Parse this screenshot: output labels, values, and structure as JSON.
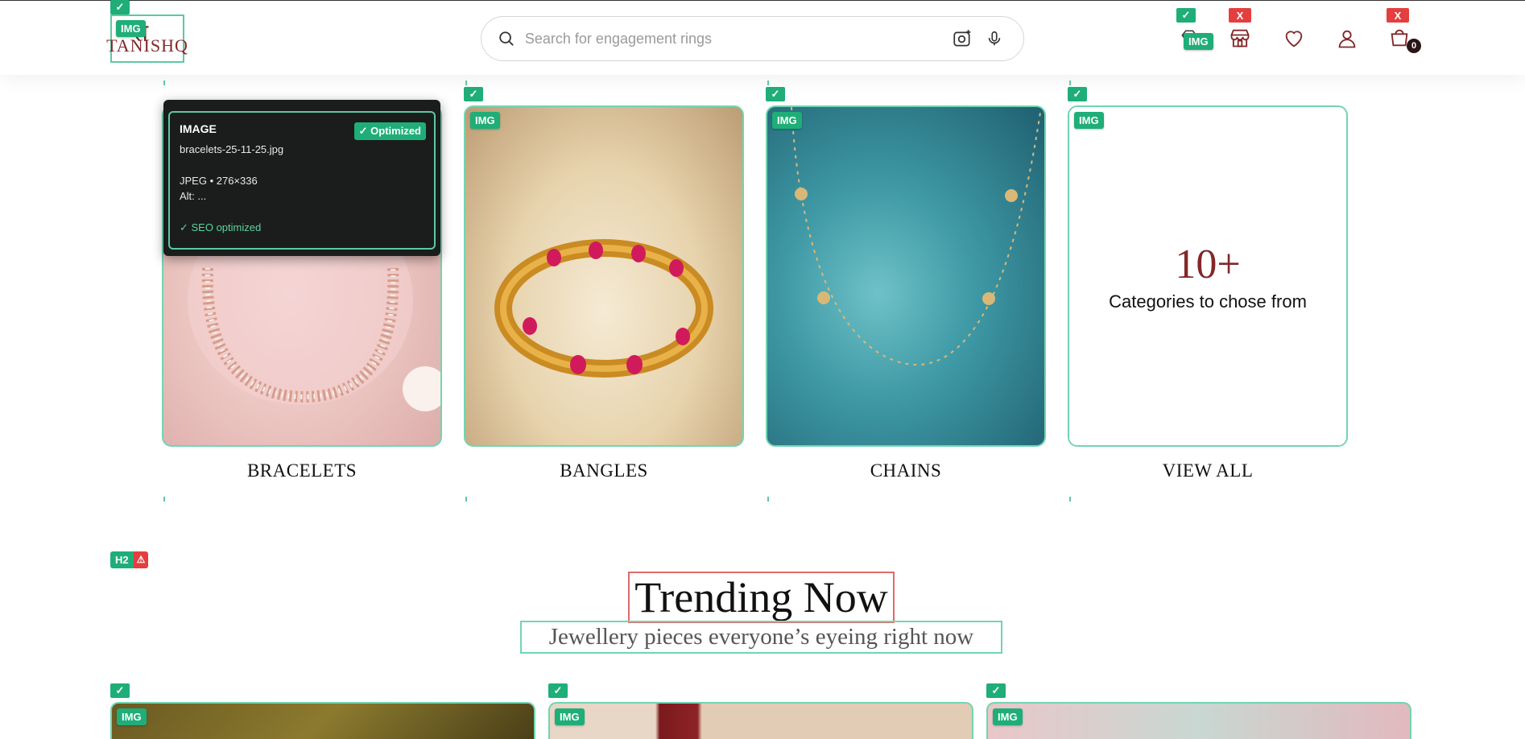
{
  "header": {
    "logo_text": "TANISHQ",
    "search": {
      "placeholder": "Search for engagement rings"
    },
    "cart_count": "0",
    "icons": [
      "camera-search-icon",
      "microphone-icon",
      "diamond-icon",
      "store-icon",
      "heart-icon",
      "user-icon",
      "cart-icon"
    ]
  },
  "categories": [
    {
      "label": "BRACELETS"
    },
    {
      "label": "BANGLES"
    },
    {
      "label": "CHAINS"
    },
    {
      "label": "VIEW ALL",
      "count": "10+",
      "subtitle": "Categories to chose from"
    }
  ],
  "tooltip": {
    "title": "IMAGE",
    "filename": "bracelets-25-11-25.jpg",
    "meta": "JPEG • 276×336",
    "alt": "Alt: ...",
    "optimized": "✓ Optimized",
    "seo": "✓ SEO optimized"
  },
  "section": {
    "heading": "Trending Now",
    "subheading": "Jewellery pieces everyone’s eyeing right now"
  },
  "overlay_badges": {
    "img": "IMG",
    "check": "✓",
    "x": "X",
    "h2": "H2",
    "warn": "⚠"
  },
  "colors": {
    "brand": "#832729",
    "overlay_green": "#1fae78",
    "overlay_red": "#e53e3e",
    "outline_green": "#72d5b0"
  }
}
